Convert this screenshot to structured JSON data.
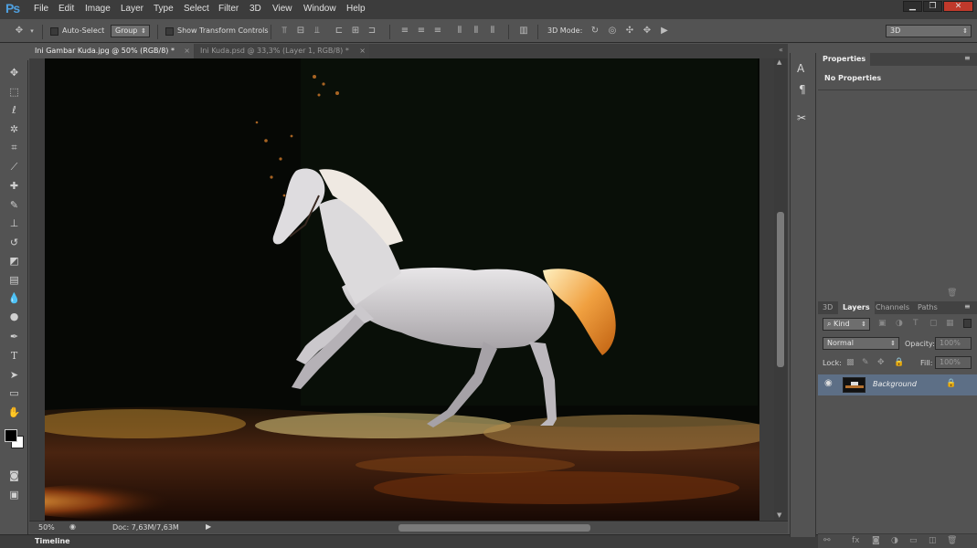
{
  "app": {
    "logo": "Ps"
  },
  "menu": [
    "File",
    "Edit",
    "Image",
    "Layer",
    "Type",
    "Select",
    "Filter",
    "3D",
    "View",
    "Window",
    "Help"
  ],
  "window_controls": {
    "minimize": "▁",
    "restore": "❐",
    "close": "✕"
  },
  "options": {
    "auto_select_label": "Auto-Select",
    "auto_select_target": "Group",
    "transform_label": "Show Transform Controls",
    "mode_3d_label": "3D Mode:",
    "workspace": "3D"
  },
  "tabs": [
    {
      "label": "Ini Gambar Kuda.jpg @ 50% (RGB/8) *",
      "active": true
    },
    {
      "label": "Ini Kuda.psd @ 33,3% (Layer 1, RGB/8) *",
      "active": false
    }
  ],
  "status": {
    "zoom": "50%",
    "doc": "Doc: 7,63M/7,63M"
  },
  "timeline": {
    "label": "Timeline"
  },
  "properties": {
    "tab": "Properties",
    "content": "No Properties"
  },
  "layers_panel": {
    "tabs": [
      "3D",
      "Layers",
      "Channels",
      "Paths"
    ],
    "active_tab": "Layers",
    "filter_label": "Kind",
    "blend_mode": "Normal",
    "opacity_label": "Opacity:",
    "opacity_value": "100%",
    "lock_label": "Lock:",
    "fill_label": "Fill:",
    "fill_value": "100%",
    "layers": [
      {
        "name": "Background",
        "visible": true,
        "locked": true
      }
    ]
  },
  "colors": {
    "accent": "#4fa0e0",
    "selected_layer": "#5d6f86",
    "panel_bg": "#535353"
  },
  "icons": {
    "tools": [
      "move-tool-icon",
      "marquee-tool-icon",
      "lasso-tool-icon",
      "magic-wand-tool-icon",
      "crop-tool-icon",
      "eyedropper-tool-icon",
      "healing-brush-tool-icon",
      "brush-tool-icon",
      "clone-stamp-tool-icon",
      "history-brush-tool-icon",
      "eraser-tool-icon",
      "gradient-tool-icon",
      "blur-tool-icon",
      "dodge-tool-icon",
      "pen-tool-icon",
      "type-tool-icon",
      "path-selection-tool-icon",
      "shape-tool-icon",
      "hand-tool-icon",
      "zoom-tool-icon"
    ]
  }
}
